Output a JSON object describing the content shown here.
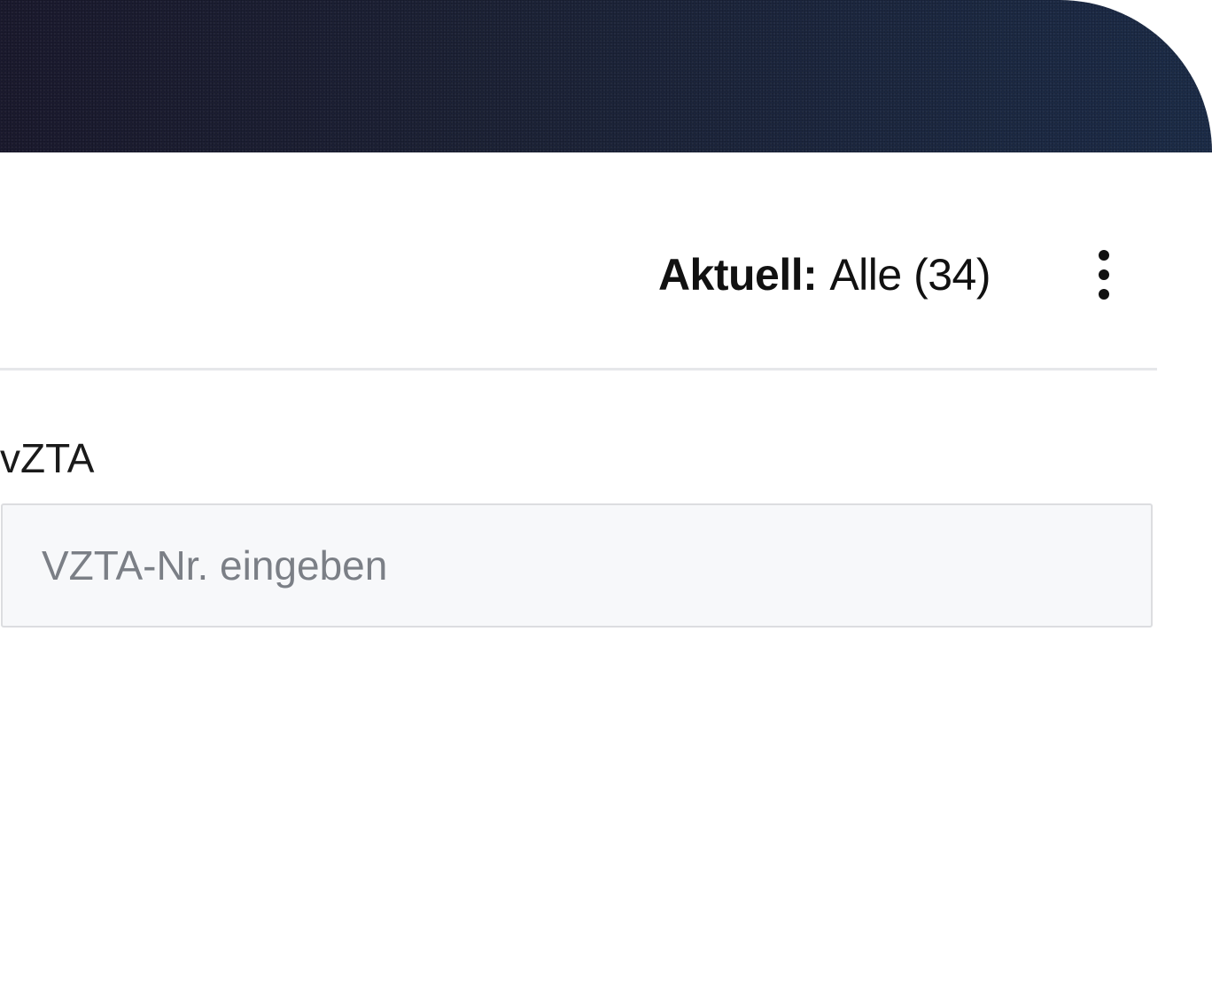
{
  "header": {
    "background_color_start": "#1b1a2e",
    "background_color_end": "#1c2c48"
  },
  "toolbar": {
    "current_prefix": "Aktuell:",
    "current_value": "Alle (34)",
    "more_icon": "more-vertical-icon"
  },
  "form": {
    "vzta_label": "vZTA",
    "vzta_input": {
      "value": "",
      "placeholder": "VZTA-Nr. eingeben"
    }
  }
}
